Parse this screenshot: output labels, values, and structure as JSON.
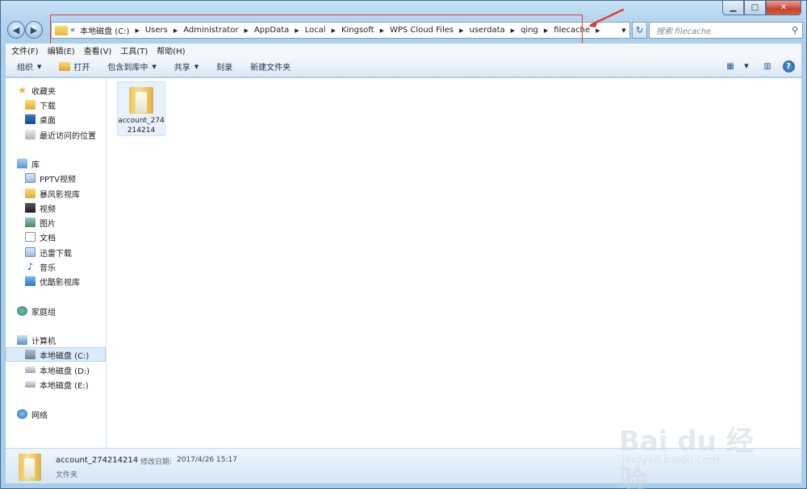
{
  "window": {
    "min_label": "▁",
    "max_label": "□",
    "close_label": "✕"
  },
  "address": {
    "prefix": "«",
    "crumbs": [
      "本地磁盘 (C:)",
      "Users",
      "Administrator",
      "AppData",
      "Local",
      "Kingsoft",
      "WPS Cloud Files",
      "userdata",
      "qing",
      "filecache"
    ],
    "crumb_separator": "▶",
    "dropdown_glyph": "▼",
    "refresh_glyph": "↻"
  },
  "search": {
    "placeholder": "搜索 filecache",
    "icon": "magnifier-icon"
  },
  "menu": {
    "items": [
      "文件(F)",
      "编辑(E)",
      "查看(V)",
      "工具(T)",
      "帮助(H)"
    ]
  },
  "toolbar": {
    "organize": "组织",
    "open": "打开",
    "include_in_library": "包含到库中",
    "share": "共享",
    "burn": "刻录",
    "new_folder": "新建文件夹",
    "caret": "▼",
    "help_glyph": "?"
  },
  "nav": {
    "favorites": {
      "title": "收藏夹",
      "items": [
        "下载",
        "桌面",
        "最近访问的位置"
      ]
    },
    "libraries": {
      "title": "库",
      "items": [
        "PPTV视频",
        "暴风影视库",
        "视频",
        "图片",
        "文档",
        "迅雷下载",
        "音乐",
        "优酷影视库"
      ]
    },
    "homegroup": "家庭组",
    "computer": {
      "title": "计算机",
      "items": [
        "本地磁盘 (C:)",
        "本地磁盘 (D:)",
        "本地磁盘 (E:)"
      ]
    },
    "network": "网络"
  },
  "files": [
    {
      "name": "account_274214214"
    }
  ],
  "details": {
    "name": "account_274214214",
    "modified_label": "修改日期:",
    "modified_value": "2017/4/26 15:17",
    "type": "文件夹"
  },
  "watermark": {
    "logo_text": "Bai du 经验",
    "url": "jingyan.baidu.com"
  },
  "colors": {
    "annotation": "#e0403a",
    "accent": "#3c6d94"
  }
}
